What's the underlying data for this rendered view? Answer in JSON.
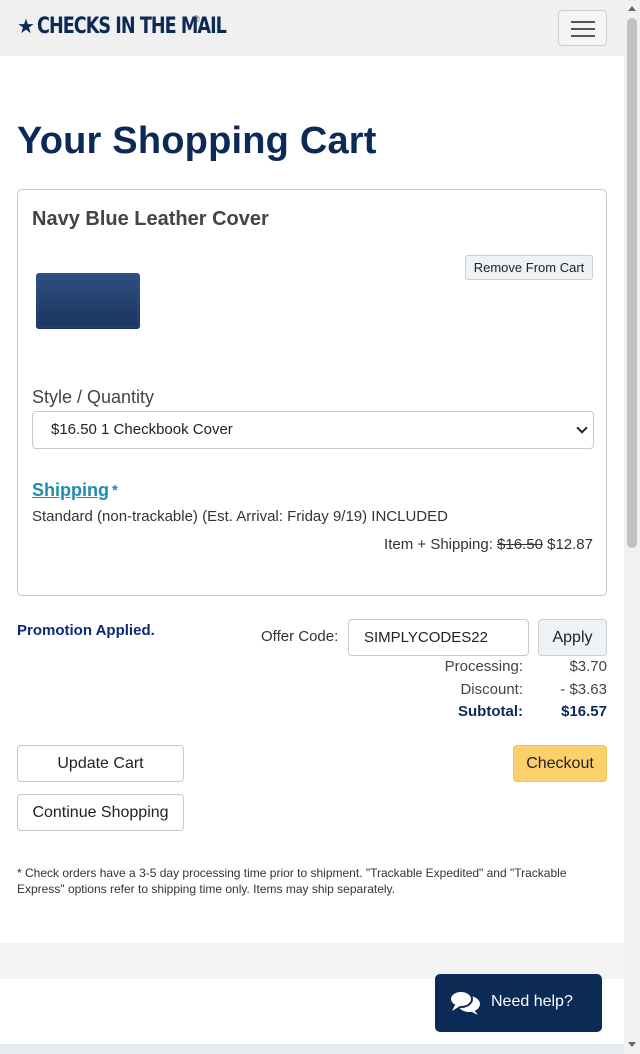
{
  "header": {
    "logo_text": "CHECKS IN THE MAIL",
    "logo_star": "★",
    "logo_reg": "®",
    "menu_icon": "hamburger-menu-icon"
  },
  "page": {
    "title": "Your Shopping Cart"
  },
  "cart": {
    "product_title": "Navy Blue Leather Cover",
    "remove_label": "Remove From Cart",
    "product_image_icon": "checkbook-cover-image",
    "product_color": "#1f3a66",
    "style_label": "Style / Quantity",
    "style_selected": "$16.50 1 Checkbook Cover",
    "shipping_label": "Shipping",
    "shipping_star": "*",
    "shipping_desc": "Standard (non-trackable) (Est. Arrival: Friday 9/19) INCLUDED",
    "item_shipping_label": "Item + Shipping:",
    "item_shipping_old": "$16.50",
    "item_shipping_new": "$12.87"
  },
  "promo": {
    "message": "Promotion Applied.",
    "offer_label": "Offer Code:",
    "offer_value": "SIMPLYCODES22",
    "apply_label": "Apply"
  },
  "totals": {
    "processing_label": "Processing:",
    "processing_value": "$3.70",
    "discount_label": "Discount:",
    "discount_value": "- $3.63",
    "subtotal_label": "Subtotal:",
    "subtotal_value": "$16.57"
  },
  "actions": {
    "update_label": "Update Cart",
    "continue_label": "Continue Shopping",
    "checkout_label": "Checkout"
  },
  "footnote": "* Check orders have a 3-5 day processing time prior to shipment. \"Trackable Expedited\" and \"Trackable Express\" options refer to shipping time only. Items may ship separately.",
  "chat": {
    "label": "Need help?",
    "icon": "chat-bubbles-icon"
  },
  "colors": {
    "brand_navy": "#0b2a55",
    "link_teal": "#1f8bb0",
    "checkout_yellow": "#fcd06a"
  }
}
